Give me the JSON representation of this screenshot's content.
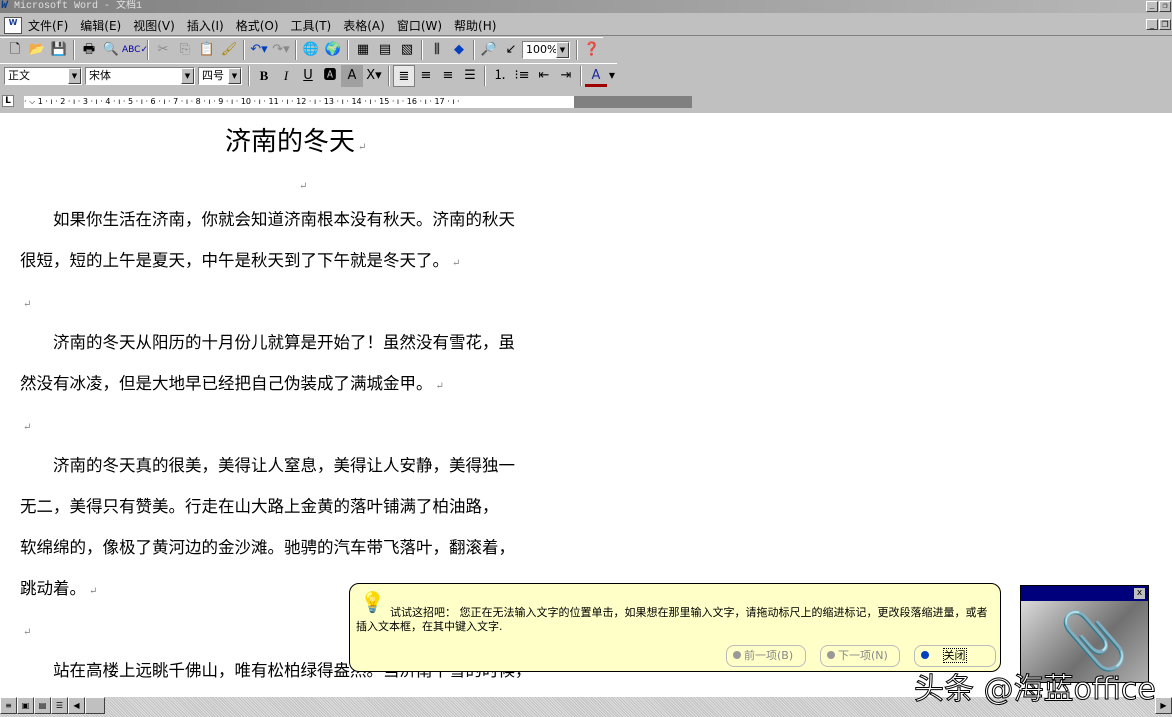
{
  "window": {
    "title": "Microsoft Word - 文档1",
    "minimize": "_",
    "restore": "❐"
  },
  "menu": [
    "文件(F)",
    "编辑(E)",
    "视图(V)",
    "插入(I)",
    "格式(O)",
    "工具(T)",
    "表格(A)",
    "窗口(W)",
    "帮助(H)"
  ],
  "toolbar": {
    "zoom": "100%"
  },
  "format": {
    "style": "正文",
    "font": "宋体",
    "size": "四号"
  },
  "ruler": "· ⌵ 1 · ı · 2 · ı · 3 · ı · 4 · ı · 5 · ı · 6 · ı · 7 · ı · 8 · ı · 9 · ı · 10 · ı · 11 · ı · 12 · ı · 13 · ı · 14 · ı · 15 · ı · 16 · ı · 17 · ı ·",
  "document": {
    "title": "济南的冬天",
    "lines": [
      "　　如果你生活在济南，你就会知道济南根本没有秋天。济南的秋天",
      "很短，短的上午是夏天，中午是秋天到了下午就是冬天了。",
      "",
      "　　济南的冬天从阳历的十月份儿就算是开始了！虽然没有雪花，虽",
      "然没有冰凌，但是大地早已经把自己伪装成了满城金甲。",
      "",
      "　　济南的冬天真的很美，美得让人窒息，美得让人安静，美得独一",
      "无二，美得只有赞美。行走在山大路上金黄的落叶铺满了柏油路，",
      "软绵绵的，像极了黄河边的金沙滩。驰骋的汽车带飞落叶，翻滚着，",
      "跳动着。",
      "",
      "　　站在高楼上远眺千佛山，唯有松柏绿得盎然。当济南下雪的时候，"
    ],
    "para_mark": "↵"
  },
  "tip": {
    "text": "试试这招吧： 您正在无法输入文字的位置单击，如果想在那里输入文字，请拖动标尺上的缩进标记，更改段落缩进量，或者插入文本框，在其中键入文字.",
    "prev": "前一项(B)",
    "next": "下一项(N)",
    "close": "关闭"
  },
  "assistant": {
    "close": "x"
  },
  "watermark": "头条 @海蓝office"
}
